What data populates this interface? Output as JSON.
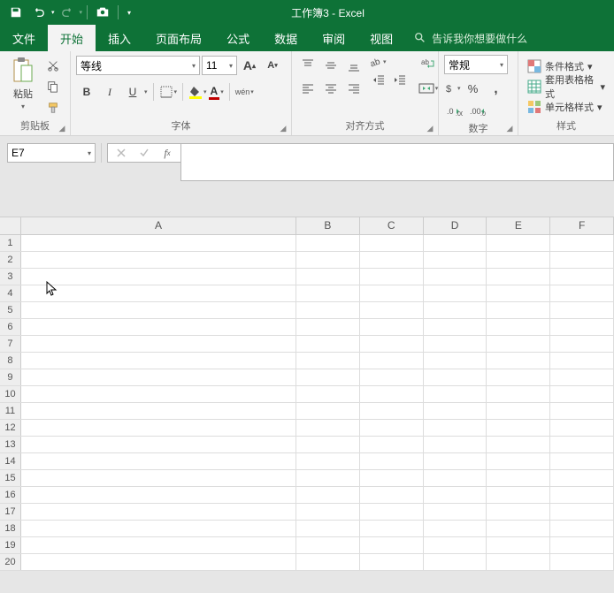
{
  "titlebar": {
    "title": "工作簿3  -  Excel"
  },
  "tabs": {
    "file": "文件",
    "home": "开始",
    "insert": "插入",
    "page_layout": "页面布局",
    "formulas": "公式",
    "data": "数据",
    "review": "审阅",
    "view": "视图",
    "tell_me": "告诉我你想要做什么"
  },
  "ribbon": {
    "clipboard": {
      "paste": "粘贴",
      "label": "剪贴板"
    },
    "font": {
      "name": "等线",
      "size": "11",
      "bold": "B",
      "italic": "I",
      "underline": "U",
      "phonetic": "wén",
      "label": "字体",
      "increase": "A",
      "decrease": "A"
    },
    "alignment": {
      "label": "对齐方式"
    },
    "number": {
      "format": "常规",
      "label": "数字"
    },
    "styles": {
      "conditional": "条件格式",
      "table": "套用表格格式",
      "cell_styles": "单元格样式",
      "label": "样式"
    }
  },
  "namebox": {
    "value": "E7"
  },
  "grid": {
    "columns": [
      "A",
      "B",
      "C",
      "D",
      "E",
      "F"
    ],
    "rows": [
      "1",
      "2",
      "3",
      "4",
      "5",
      "6",
      "7",
      "8",
      "9",
      "10",
      "11",
      "12",
      "13",
      "14",
      "15",
      "16",
      "17",
      "18",
      "19",
      "20"
    ]
  }
}
